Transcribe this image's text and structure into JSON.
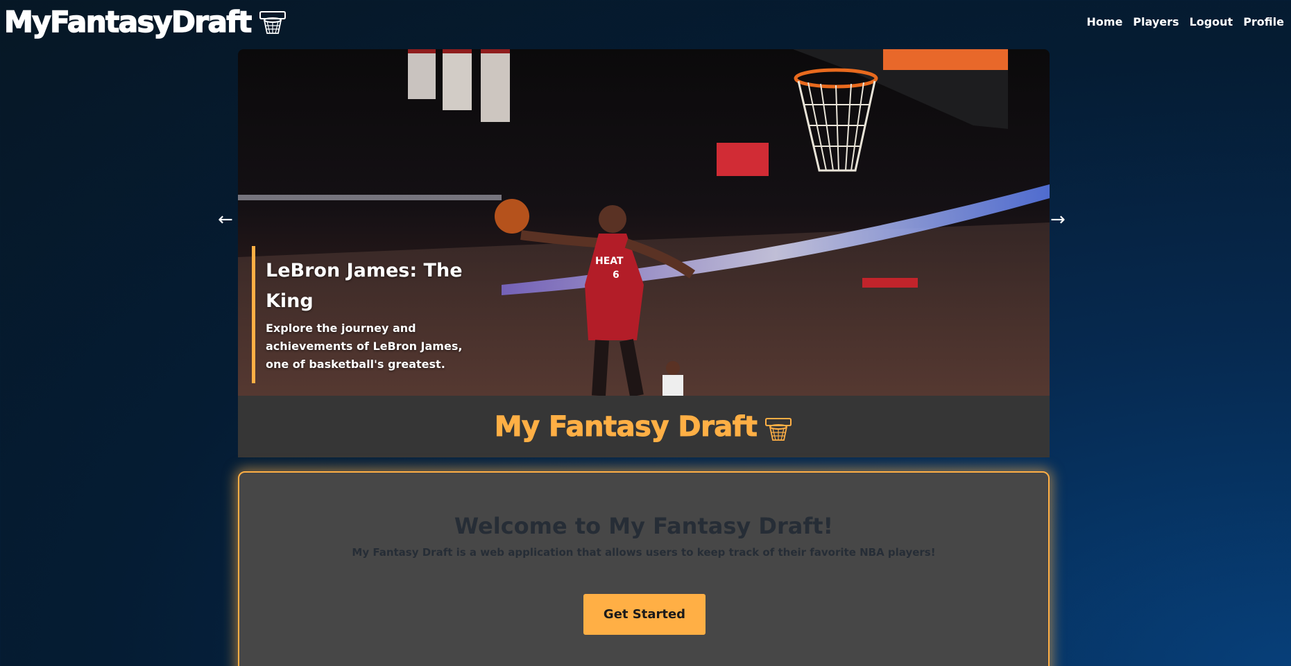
{
  "header": {
    "logo_text": "MyFantasyDraft",
    "logo_icon": "basketball-hoop-icon",
    "nav": [
      {
        "label": "Home"
      },
      {
        "label": "Players"
      },
      {
        "label": "Logout"
      },
      {
        "label": "Profile"
      }
    ]
  },
  "carousel": {
    "prev_arrow": "←",
    "next_arrow": "→",
    "slide": {
      "image_description": "LeBron James dunking in a Miami Heat jersey",
      "title": "LeBron James: The King",
      "text": "Explore the journey and achievements of LeBron James, one of basketball's greatest."
    }
  },
  "banner": {
    "title": "My Fantasy Draft",
    "icon": "basketball-hoop-icon"
  },
  "welcome": {
    "title": "Welcome to My Fantasy Draft!",
    "description": "My Fantasy Draft is a web application that allows users to keep track of their favorite NBA players!",
    "button_label": "Get Started"
  },
  "colors": {
    "accent": "#ffaf45",
    "banner_bg": "#363636",
    "card_bg": "#474747",
    "card_text": "#262d36"
  }
}
